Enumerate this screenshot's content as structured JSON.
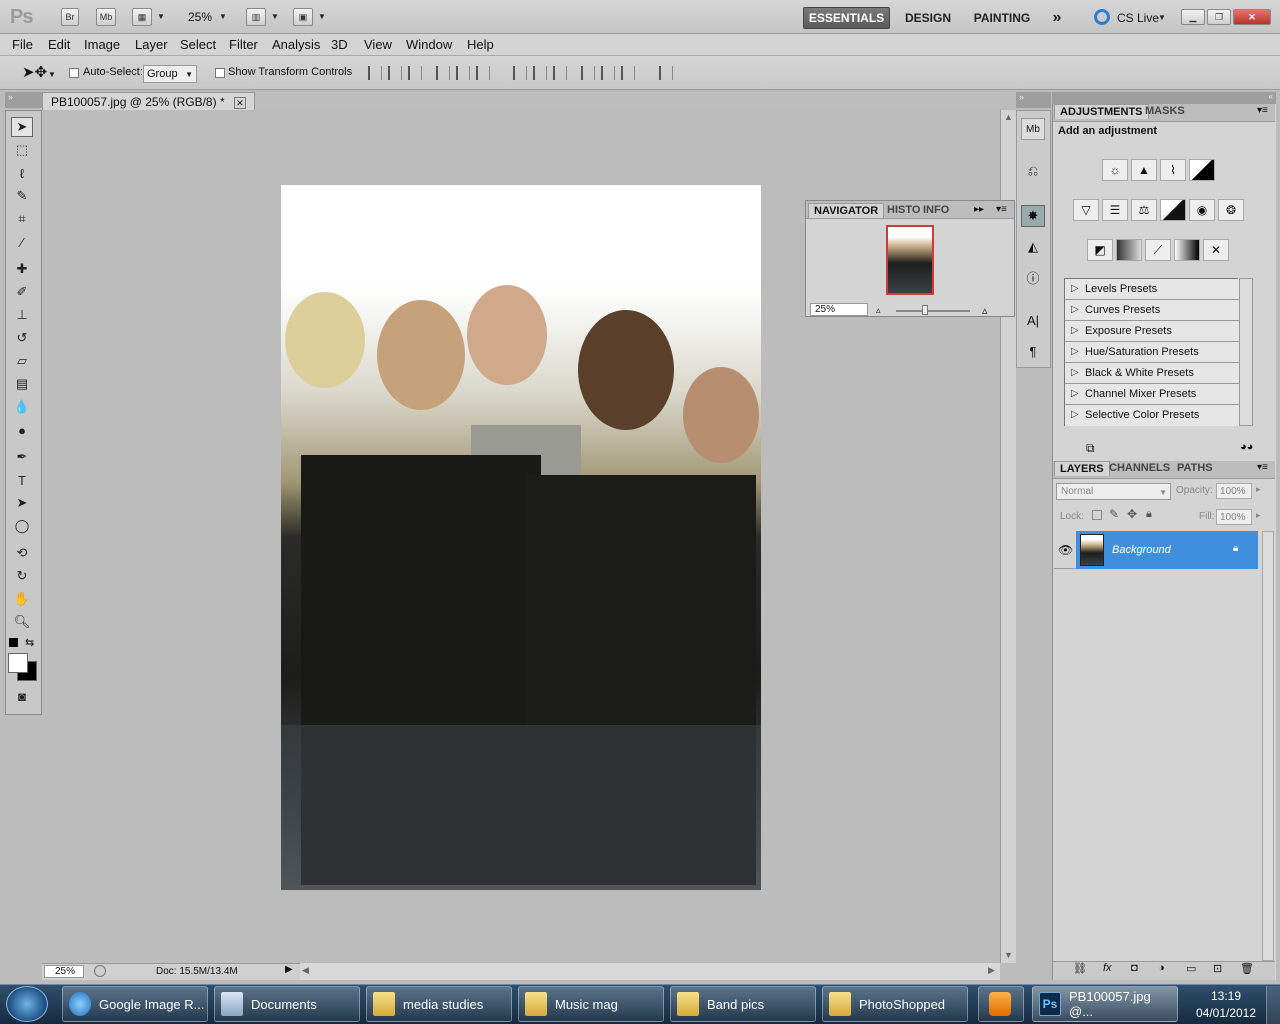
{
  "app": {
    "logo": "Ps",
    "bridge_label": "Br",
    "minibridge_label": "Mb",
    "zoom_select": "25%",
    "workspaces": [
      "ESSENTIALS",
      "DESIGN",
      "PAINTING"
    ],
    "more_workspaces": "»",
    "cs_live": "CS Live"
  },
  "menu": [
    "File",
    "Edit",
    "Image",
    "Layer",
    "Select",
    "Filter",
    "Analysis",
    "3D",
    "View",
    "Window",
    "Help"
  ],
  "options": {
    "auto_select_label": "Auto-Select:",
    "auto_select_value": "Group",
    "transform_label": "Show Transform Controls"
  },
  "document": {
    "tab_title": "PB100057.jpg @ 25% (RGB/8) *",
    "close": "✕",
    "zoom": "25%",
    "doc_info": "Doc: 15.5M/13.4M"
  },
  "navigator": {
    "tabs": [
      "NAVIGATOR",
      "HISTO",
      "INFO"
    ],
    "zoom": "25%"
  },
  "adjustments": {
    "tabs": [
      "ADJUSTMENTS",
      "MASKS"
    ],
    "heading": "Add an adjustment",
    "presets": [
      "Levels Presets",
      "Curves Presets",
      "Exposure Presets",
      "Hue/Saturation Presets",
      "Black & White Presets",
      "Channel Mixer Presets",
      "Selective Color Presets"
    ]
  },
  "layers": {
    "tabs": [
      "LAYERS",
      "CHANNELS",
      "PATHS"
    ],
    "blend_mode": "Normal",
    "opacity_label": "Opacity:",
    "opacity_value": "100%",
    "lock_label": "Lock:",
    "fill_label": "Fill:",
    "fill_value": "100%",
    "layer_name": "Background"
  },
  "taskbar": {
    "items": [
      "Google Image R...",
      "Documents",
      "media studies",
      "Music mag",
      "Band pics",
      "PhotoShopped",
      "PB100057.jpg @..."
    ],
    "time": "13:19",
    "date": "04/01/2012"
  },
  "colors": {
    "accent": "#3f8fdc",
    "taskbar": "#1c344e"
  }
}
